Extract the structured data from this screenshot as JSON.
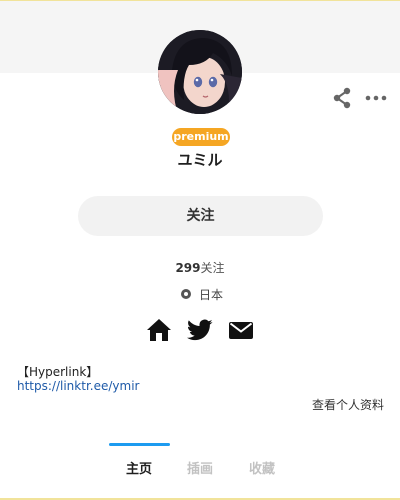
{
  "profile": {
    "badge": "premium",
    "name": "ユミル",
    "followers_count": "299",
    "followers_suffix": "关注",
    "location": "日本"
  },
  "actions": {
    "follow_label": "关注"
  },
  "bio": {
    "title": "【Hyperlink】",
    "link": "https://linktr.ee/ymir"
  },
  "profile_link_label": "查看个人资料",
  "tabs": [
    {
      "label": "主页",
      "active": true
    },
    {
      "label": "插画",
      "active": false
    },
    {
      "label": "收藏",
      "active": false
    }
  ],
  "icons": {
    "header_actions": [
      "share-icon",
      "more-icon"
    ],
    "location": "location-pin-icon",
    "social_links": [
      "home-icon",
      "twitter-icon",
      "mail-icon"
    ]
  },
  "colors": {
    "premium": "#f5a623",
    "active_tab_indicator": "#1d9bf0",
    "link": "#1e5aa8",
    "header_bg": "#f5f5f5",
    "follow_button_bg": "#f2f2f2"
  }
}
